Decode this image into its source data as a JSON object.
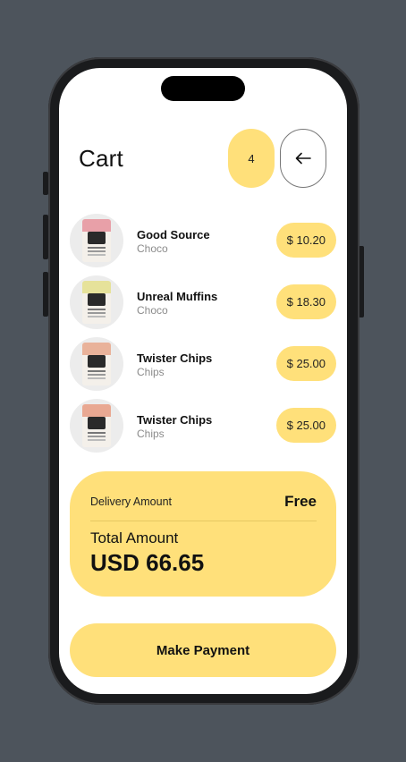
{
  "header": {
    "title": "Cart",
    "item_count": "4",
    "back_icon": "arrow-left-icon"
  },
  "items": [
    {
      "name": "Good Source",
      "category": "Choco",
      "price": "$ 10.20",
      "pack_color": "#e8a0a8"
    },
    {
      "name": "Unreal Muffins",
      "category": "Choco",
      "price": "$ 18.30",
      "pack_color": "#e6e29a"
    },
    {
      "name": "Twister Chips",
      "category": "Chips",
      "price": "$ 25.00",
      "pack_color": "#e9b29a"
    },
    {
      "name": "Twister Chips",
      "category": "Chips",
      "price": "$ 25.00",
      "pack_color": "#e9a892"
    }
  ],
  "summary": {
    "delivery_label": "Delivery Amount",
    "delivery_value": "Free",
    "total_label": "Total Amount",
    "total_value": "USD 66.65"
  },
  "actions": {
    "pay_label": "Make Payment"
  },
  "colors": {
    "accent": "#ffe07a",
    "background": "#4d545c"
  }
}
